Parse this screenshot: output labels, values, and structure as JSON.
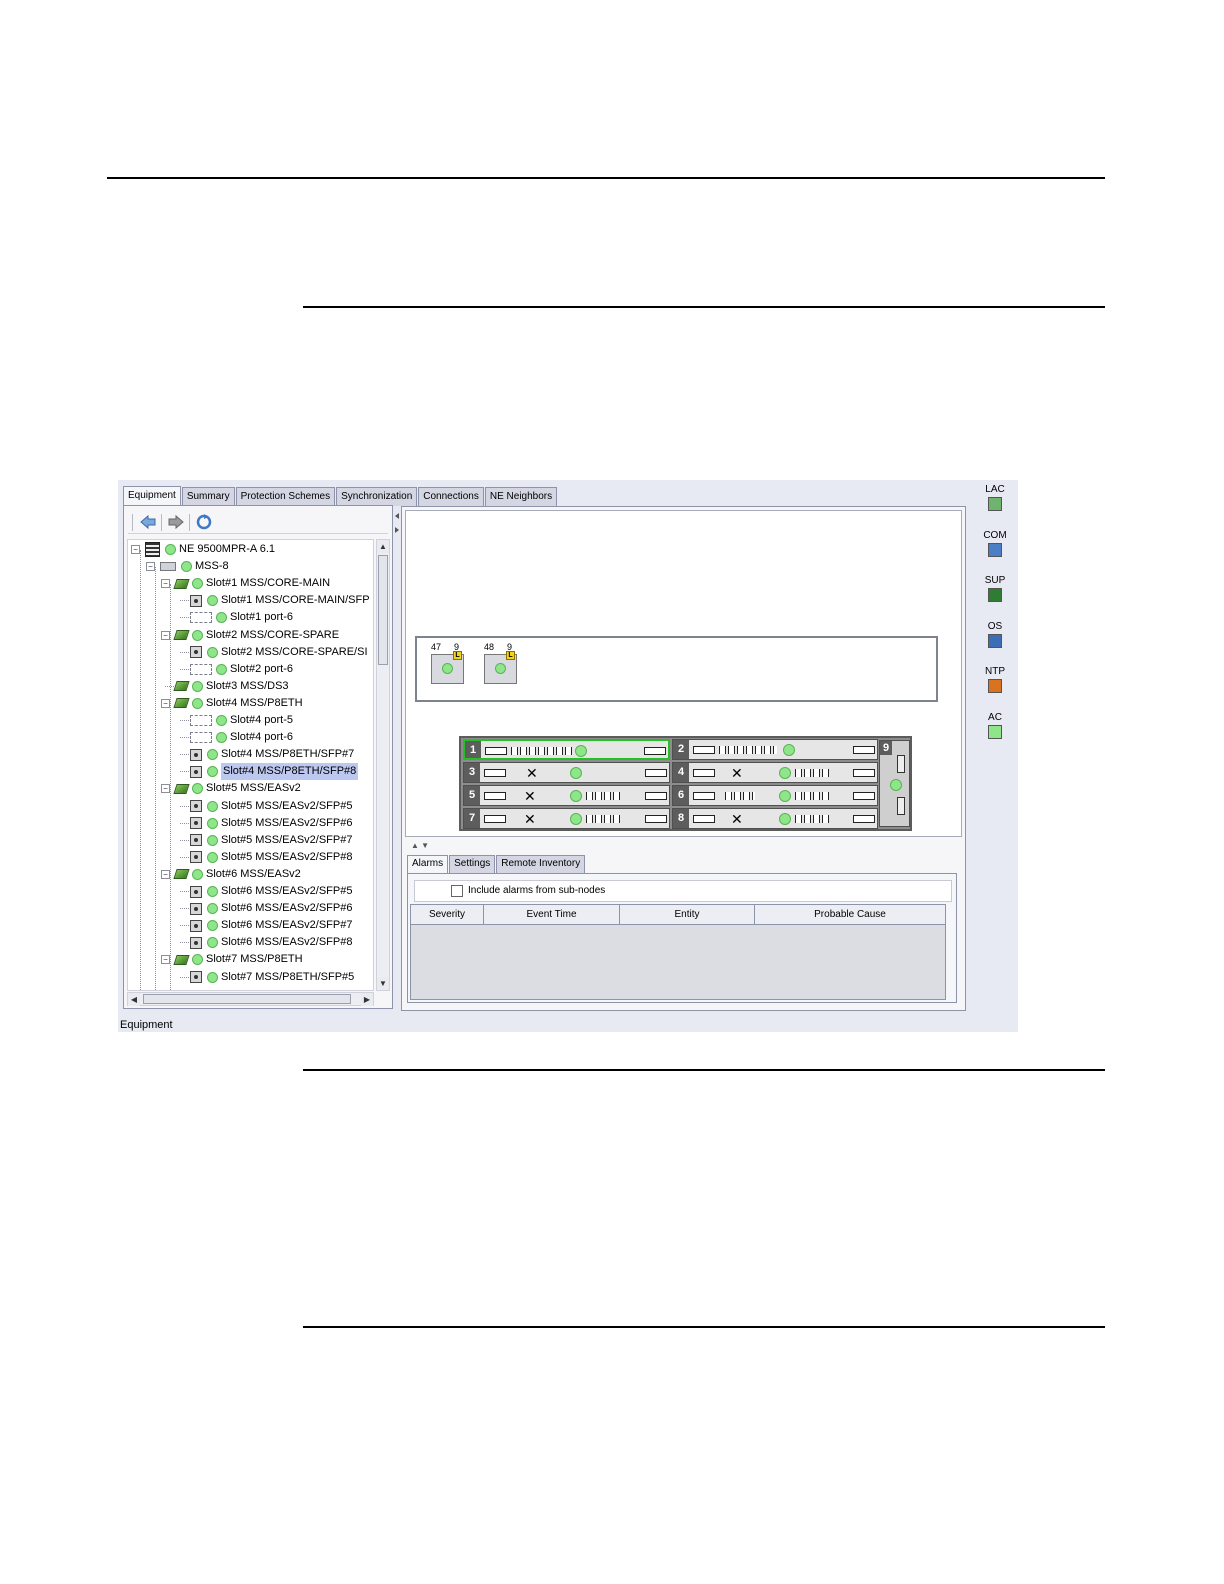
{
  "top_tabs": [
    "Equipment",
    "Summary",
    "Protection Schemes",
    "Synchronization",
    "Connections",
    "NE Neighbors"
  ],
  "toolbar": {
    "back_icon": "back-arrow-icon",
    "forward_icon": "forward-arrow-icon",
    "refresh_icon": "refresh-icon"
  },
  "tree": [
    {
      "label": "NE 9500MPR-A 6.1",
      "icon": "ne-icon"
    },
    {
      "label": "MSS-8",
      "icon": "shelf-icon"
    },
    {
      "label": "Slot#1 MSS/CORE-MAIN",
      "icon": "card-icon"
    },
    {
      "label": "Slot#1 MSS/CORE-MAIN/SFP",
      "icon": "sfp-icon"
    },
    {
      "label": "Slot#1  port-6",
      "icon": "port-icon"
    },
    {
      "label": "Slot#2 MSS/CORE-SPARE",
      "icon": "card-icon"
    },
    {
      "label": "Slot#2 MSS/CORE-SPARE/SI",
      "icon": "sfp-icon"
    },
    {
      "label": "Slot#2  port-6",
      "icon": "port-icon"
    },
    {
      "label": "Slot#3 MSS/DS3",
      "icon": "card-icon"
    },
    {
      "label": "Slot#4 MSS/P8ETH",
      "icon": "card-icon"
    },
    {
      "label": "Slot#4  port-5",
      "icon": "port-icon"
    },
    {
      "label": "Slot#4  port-6",
      "icon": "port-icon"
    },
    {
      "label": "Slot#4 MSS/P8ETH/SFP#7",
      "icon": "sfp-icon"
    },
    {
      "label": "Slot#4 MSS/P8ETH/SFP#8",
      "icon": "sfp-icon",
      "selected": true
    },
    {
      "label": "Slot#5 MSS/EASv2",
      "icon": "card-icon"
    },
    {
      "label": "Slot#5 MSS/EASv2/SFP#5",
      "icon": "sfp-icon"
    },
    {
      "label": "Slot#5 MSS/EASv2/SFP#6",
      "icon": "sfp-icon"
    },
    {
      "label": "Slot#5 MSS/EASv2/SFP#7",
      "icon": "sfp-icon"
    },
    {
      "label": "Slot#5 MSS/EASv2/SFP#8",
      "icon": "sfp-icon"
    },
    {
      "label": "Slot#6 MSS/EASv2",
      "icon": "card-icon"
    },
    {
      "label": "Slot#6 MSS/EASv2/SFP#5",
      "icon": "sfp-icon"
    },
    {
      "label": "Slot#6 MSS/EASv2/SFP#6",
      "icon": "sfp-icon"
    },
    {
      "label": "Slot#6 MSS/EASv2/SFP#7",
      "icon": "sfp-icon"
    },
    {
      "label": "Slot#6 MSS/EASv2/SFP#8",
      "icon": "sfp-icon"
    },
    {
      "label": "Slot#7 MSS/P8ETH",
      "icon": "card-icon"
    },
    {
      "label": "Slot#7 MSS/P8ETH/SFP#5",
      "icon": "sfp-icon"
    }
  ],
  "fans": [
    {
      "id": "47",
      "sub": "9"
    },
    {
      "id": "48",
      "sub": "9"
    }
  ],
  "slots": [
    "1",
    "2",
    "3",
    "4",
    "5",
    "6",
    "7",
    "8",
    "9"
  ],
  "bottom_tabs": [
    "Alarms",
    "Settings",
    "Remote Inventory"
  ],
  "alarms": {
    "include_label": "Include alarms from sub-nodes",
    "columns": [
      "Severity",
      "Event Time",
      "Entity",
      "Probable Cause"
    ]
  },
  "side_indicators": [
    {
      "label": "LAC",
      "icon": "lac-icon",
      "color": "#6fb36f"
    },
    {
      "label": "COM",
      "icon": "com-icon",
      "color": "#4a7fc8"
    },
    {
      "label": "SUP",
      "icon": "sup-icon",
      "color": "#2f7d32"
    },
    {
      "label": "OS",
      "icon": "os-icon",
      "color": "#3a6fb8"
    },
    {
      "label": "NTP",
      "icon": "ntp-icon",
      "color": "#d9731f"
    },
    {
      "label": "AC",
      "icon": "ac-icon",
      "color": "#8fe68a"
    }
  ],
  "status_label": "Equipment"
}
